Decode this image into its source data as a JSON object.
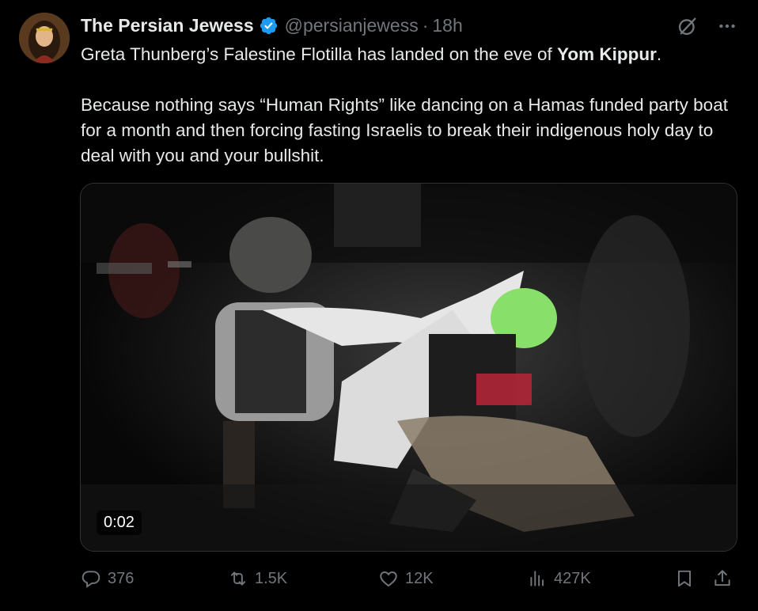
{
  "tweet": {
    "display_name": "The Persian Jewess",
    "handle": "@persianjewess",
    "separator": "·",
    "time": "18h",
    "text_line1_start": "Greta Thunberg’s Falestine Flotilla has landed on the eve of ",
    "text_line1_bold": "Yom Kippur",
    "text_line1_end": ".",
    "text_para2": "Because nothing says “Human Rights” like dancing on a Hamas funded party boat for a month and then forcing fasting Israelis to break their indigenous holy day to deal with you and your bullshit."
  },
  "media": {
    "duration": "0:02"
  },
  "actions": {
    "replies": "376",
    "reposts": "1.5K",
    "likes": "12K",
    "views": "427K"
  },
  "colors": {
    "background": "#000000",
    "text": "#e7e9ea",
    "muted": "#71767b",
    "verified_blue": "#1d9bf0"
  },
  "icons": {
    "verified": "verified-badge-icon",
    "grok": "grok-icon",
    "more": "more-dots-icon",
    "reply": "reply-icon",
    "repost": "repost-icon",
    "like": "heart-icon",
    "views": "views-chart-icon",
    "bookmark": "bookmark-icon",
    "share": "share-icon"
  }
}
